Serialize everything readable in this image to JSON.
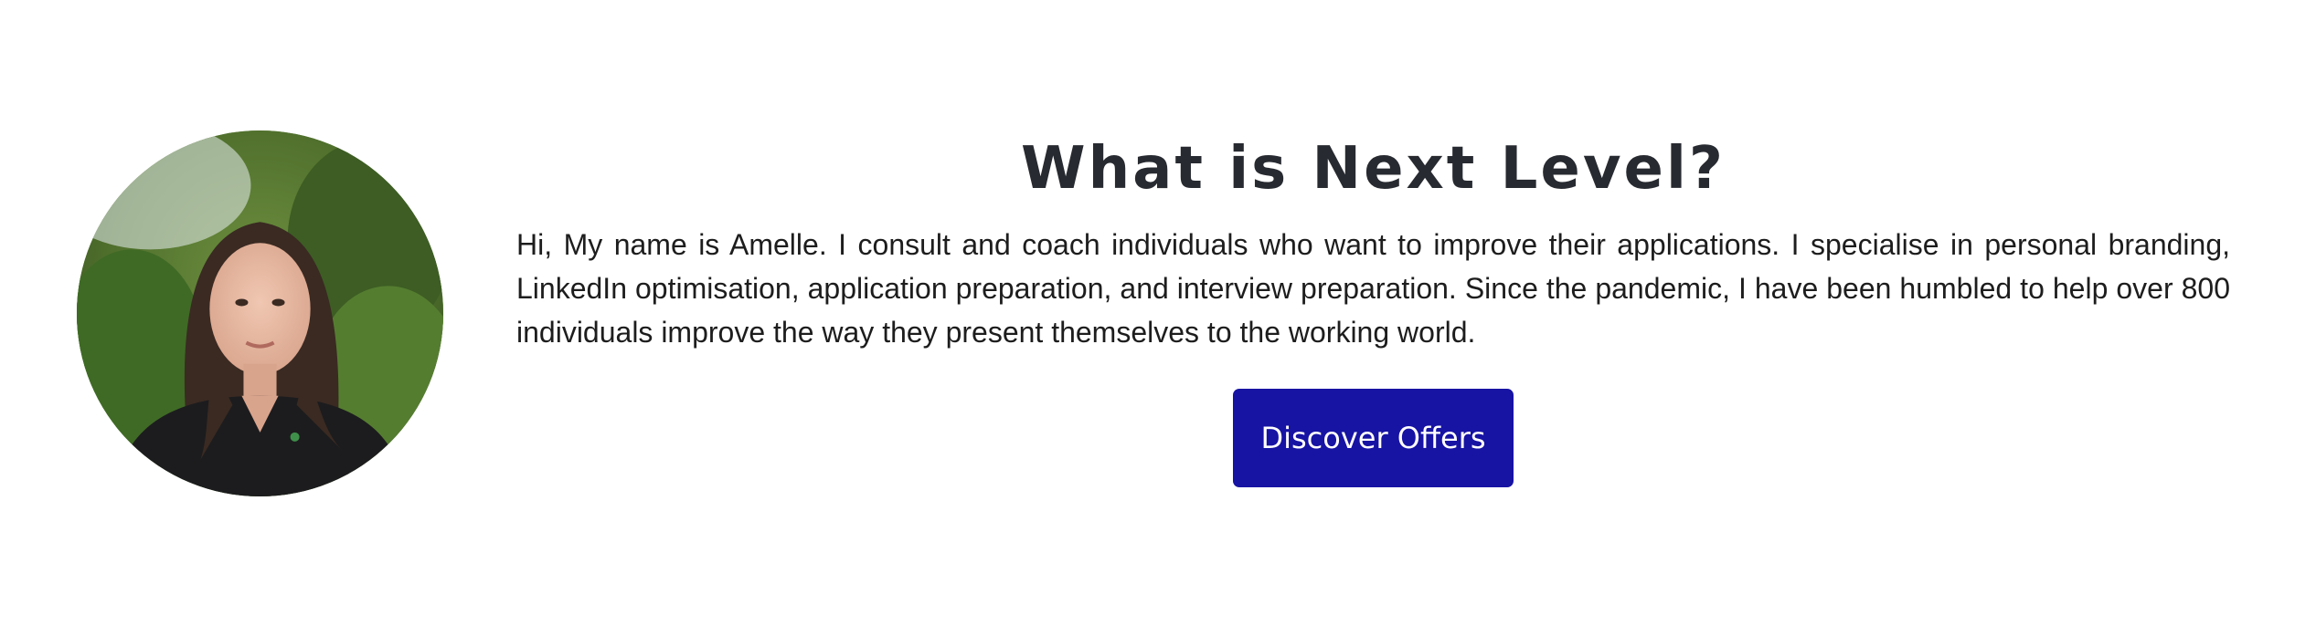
{
  "hero": {
    "avatar_alt": "Amelle",
    "title": "What is Next Level?",
    "bio": "Hi, My name is Amelle. I consult and coach individuals who want to improve their applications. I specialise in personal branding, LinkedIn optimisation, application preparation, and interview preparation. Since the pandemic, I have been humbled to help over 800 individuals improve the way they present themselves to the working world.",
    "cta_label": "Discover Offers"
  },
  "colors": {
    "button_background": "#1713a3",
    "title_text": "#272a30",
    "page_background": "#ffffff"
  }
}
